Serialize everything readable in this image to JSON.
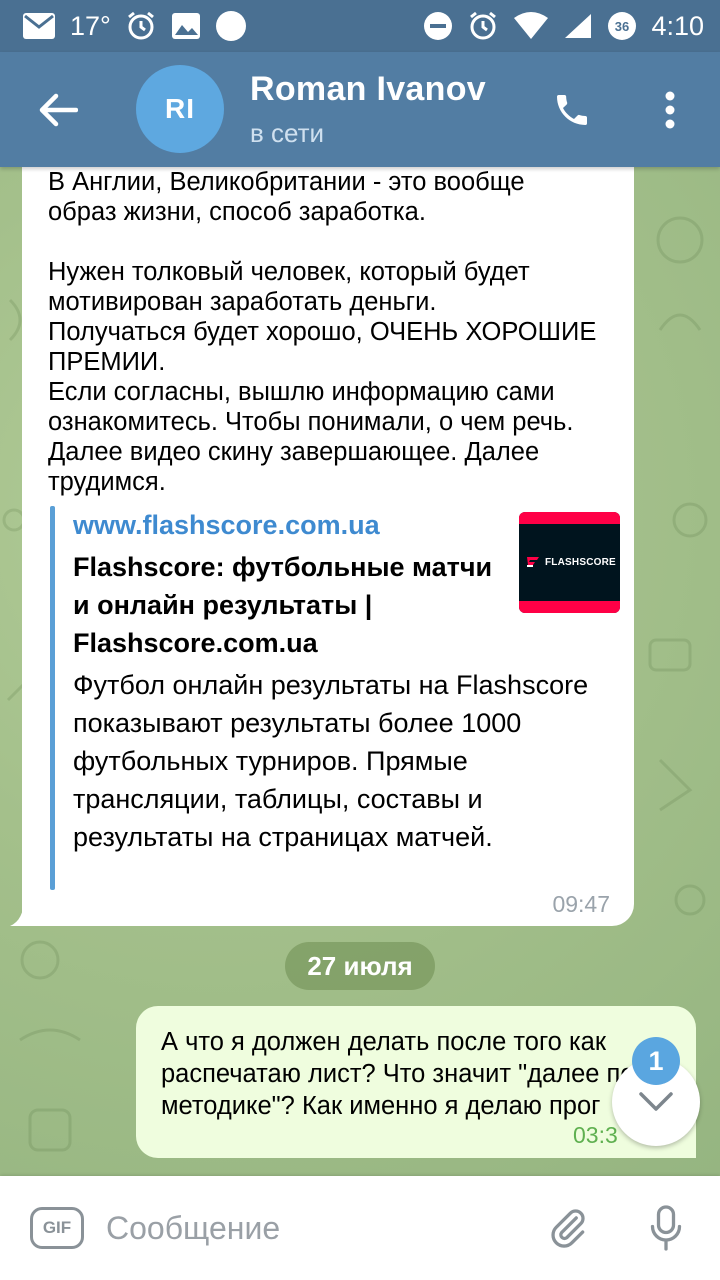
{
  "status_bar": {
    "temperature": "17°",
    "time": "4:10",
    "network_badge": "36",
    "icons": [
      "mail-icon",
      "alarm-icon",
      "image-icon",
      "circle-icon",
      "dnd-icon",
      "alarm-icon",
      "wifi-icon",
      "signal-icon",
      "battery-icon"
    ]
  },
  "header": {
    "avatar_initials": "RI",
    "avatar_color": "#5ea8e0",
    "contact_name": "Roman Ivanov",
    "contact_status": "в сети"
  },
  "messages": {
    "incoming": {
      "text": "В Англии, Великобритании - это вообще\nобраз жизни, способ заработка.\n\nНужен толковый человек, который будет\nмотивирован заработать деньги.\nПолучаться будет хорошо, ОЧЕНЬ ХОРОШИЕ\nПРЕМИИ.\nЕсли согласны, вышлю информацию сами\nознакомитесь. Чтобы понимали, о чем речь.\nДалее видео скину завершающее. Далее\nтрудимся.",
      "link_preview": {
        "site": "www.flashscore.com.ua",
        "title": "Flashscore: футбольные матчи и онлайн результаты | Flashscore.com.ua",
        "description": "Футбол онлайн результаты на Flashscore показывают результаты более 1000 футбольных турниров. Прямые трансляции, таблицы, составы и результаты на страницах матчей.",
        "thumb_logo_text": "FLASHSCORE"
      },
      "time": "09:47"
    },
    "date_separator": "27 июля",
    "outgoing": {
      "lines": [
        "А что я должен делать после того как",
        "распечатаю лист? Что значит \"далее по",
        "методике\"? Как именно я делаю прог"
      ],
      "time": "03:3"
    }
  },
  "scroll": {
    "unread_count": "1"
  },
  "input": {
    "gif_label": "GIF",
    "placeholder": "Сообщение"
  },
  "colors": {
    "header": "#527da3",
    "status_bar": "#4a7092",
    "incoming_bubble": "#ffffff",
    "outgoing_bubble": "#effdde",
    "link": "#3e8ad0",
    "accent": "#5aa6e0"
  }
}
